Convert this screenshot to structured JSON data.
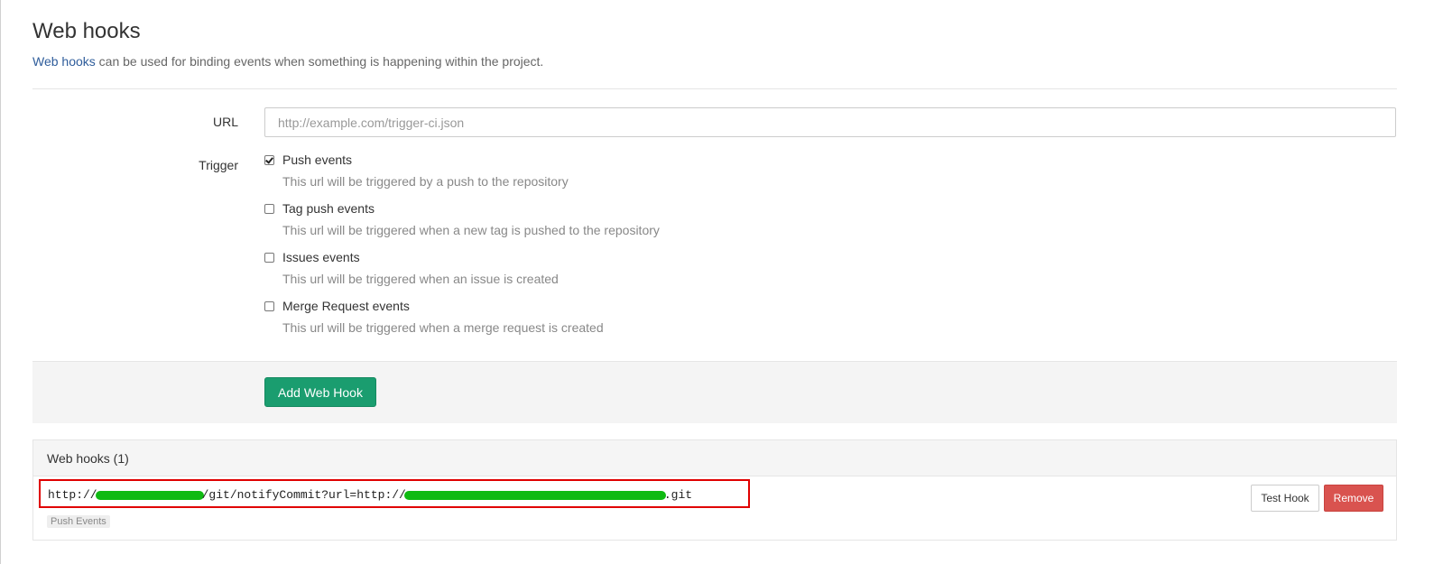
{
  "header": {
    "title": "Web hooks",
    "lead_link": "Web hooks",
    "lead_text": " can be used for binding events when something is happening within the project."
  },
  "form": {
    "url_label": "URL",
    "url_placeholder": "http://example.com/trigger-ci.json",
    "url_value": "",
    "trigger_label": "Trigger",
    "triggers": [
      {
        "label": "Push events",
        "help": "This url will be triggered by a push to the repository",
        "checked": true
      },
      {
        "label": "Tag push events",
        "help": "This url will be triggered when a new tag is pushed to the repository",
        "checked": false
      },
      {
        "label": "Issues events",
        "help": "This url will be triggered when an issue is created",
        "checked": false
      },
      {
        "label": "Merge Request events",
        "help": "This url will be triggered when a merge request is created",
        "checked": false
      }
    ],
    "submit_label": "Add Web Hook"
  },
  "hooks_panel": {
    "title": "Web hooks (1)",
    "hooks": [
      {
        "url_prefix": "http://",
        "url_middle": "/git/notifyCommit?url=http://",
        "url_suffix": ".git",
        "tag": "Push Events",
        "test_label": "Test Hook",
        "remove_label": "Remove"
      }
    ]
  },
  "colors": {
    "link": "#2f5d9b",
    "success": "#1a9d6f",
    "danger": "#d9534f",
    "highlight_box": "#e00000",
    "redaction": "#0fba12"
  }
}
